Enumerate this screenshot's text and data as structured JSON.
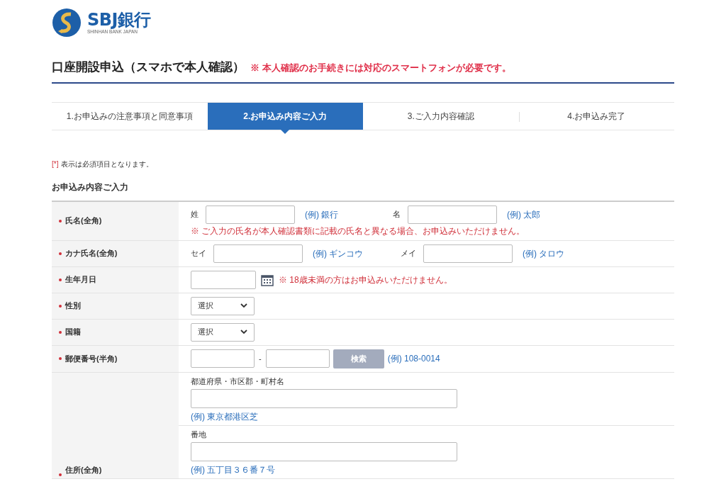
{
  "logo": {
    "name": "SBJ銀行",
    "subtitle": "SHINHAN BANK JAPAN"
  },
  "title": "口座開設申込（スマホで本人確認）",
  "title_note": "※ 本人確認のお手続きには対応のスマートフォンが必要です。",
  "steps": [
    {
      "label": "1.お申込みの注意事項と同意事項",
      "selected": false
    },
    {
      "label": "2.お申込み内容ご入力",
      "selected": true
    },
    {
      "label": "3.ご入力内容確認",
      "selected": false
    },
    {
      "label": "4.お申込み完了",
      "selected": false
    }
  ],
  "required_mark": "[*]",
  "required_text": "表示は必須項目となります。",
  "section_title": "お申込み内容ご入力",
  "rows": [
    {
      "kind": "pair",
      "label": "氏名(全角)",
      "required": true,
      "parts": [
        {
          "prefix": "姓",
          "example": "(例) 銀行"
        },
        {
          "prefix": "名",
          "example": "(例) 太郎"
        }
      ],
      "note": "※ ご入力の氏名が本人確認書類に記載の氏名と異なる場合、お申込みいただけません。"
    },
    {
      "kind": "pair",
      "label": "カナ氏名(全角)",
      "required": true,
      "parts": [
        {
          "prefix": "セイ",
          "example": "(例) ギンコウ"
        },
        {
          "prefix": "メイ",
          "example": "(例) タロウ"
        }
      ]
    },
    {
      "kind": "date",
      "label": "生年月日",
      "required": true,
      "note": "※ 18歳未満の方はお申込みいただけません。"
    },
    {
      "kind": "select",
      "label": "性別",
      "required": true,
      "value": "選択"
    },
    {
      "kind": "select",
      "label": "国籍",
      "required": true,
      "value": "選択"
    },
    {
      "kind": "postal",
      "label": "郵便番号(半角)",
      "required": true,
      "separator": "-",
      "button": {
        "label": "検索",
        "disabled": true
      },
      "example": "(例) 108-0014"
    },
    {
      "kind": "address",
      "label": "住所(全角)",
      "required": true,
      "parts": [
        {
          "caption": "都道府県・市区郡・町村名",
          "example": "(例) 東京都港区芝"
        },
        {
          "caption": "番地",
          "example": "(例) 五丁目３６番７号"
        }
      ]
    }
  ]
}
